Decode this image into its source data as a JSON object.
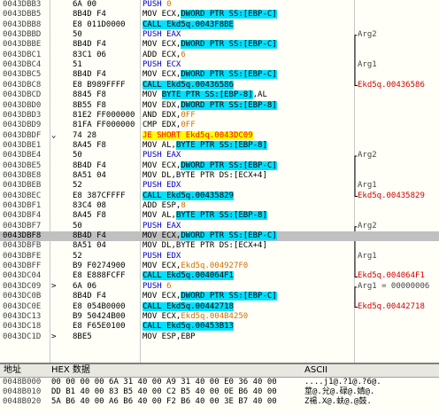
{
  "disasm": [
    {
      "addr": "0043DBB3",
      "hex": "6A 00",
      "parts": [
        [
          "PUSH ",
          "blue"
        ],
        [
          "0",
          "orange"
        ]
      ],
      "comment": ""
    },
    {
      "addr": "0043DBB5",
      "hex": "8B4D F4",
      "parts": [
        [
          "MOV ECX,",
          ""
        ],
        [
          "DWORD PTR SS:[EBP-C]",
          "hl"
        ]
      ],
      "comment": ""
    },
    {
      "addr": "0043DBB8",
      "hex": "E8 011D0000",
      "parts": [
        [
          "CALL Ekd5q.0043F8BE",
          "hl-call"
        ]
      ],
      "comment": ""
    },
    {
      "addr": "0043DBBD",
      "hex": "50",
      "parts": [
        [
          "PUSH EAX",
          "blue"
        ]
      ],
      "comment": "Arg2"
    },
    {
      "addr": "0043DBBE",
      "hex": "8B4D F4",
      "parts": [
        [
          "MOV ECX,",
          ""
        ],
        [
          "DWORD PTR SS:[EBP-C]",
          "hl"
        ]
      ],
      "comment": ""
    },
    {
      "addr": "0043DBC1",
      "hex": "83C1 06",
      "parts": [
        [
          "ADD ECX,",
          ""
        ],
        [
          "6",
          "orange"
        ]
      ],
      "comment": ""
    },
    {
      "addr": "0043DBC4",
      "hex": "51",
      "parts": [
        [
          "PUSH ECX",
          "blue"
        ]
      ],
      "comment": "Arg1"
    },
    {
      "addr": "0043DBC5",
      "hex": "8B4D F4",
      "parts": [
        [
          "MOV ECX,",
          ""
        ],
        [
          "DWORD PTR SS:[EBP-C]",
          "hl"
        ]
      ],
      "comment": ""
    },
    {
      "addr": "0043DBC8",
      "hex": "E8 B989FFFF",
      "parts": [
        [
          "CALL Ekd5q.00436586",
          "hl-call"
        ]
      ],
      "comment": "Ekd5q.00436586",
      "commentRed": true
    },
    {
      "addr": "0043DBCD",
      "hex": "8845 F8",
      "parts": [
        [
          "MOV ",
          ""
        ],
        [
          "BYTE PTR SS:[EBP-8]",
          "hl"
        ],
        [
          ",AL",
          ""
        ]
      ],
      "comment": ""
    },
    {
      "addr": "0043DBD0",
      "hex": "8B55 F8",
      "parts": [
        [
          "MOV EDX,",
          ""
        ],
        [
          "DWORD PTR SS:[EBP-8]",
          "hl"
        ]
      ],
      "comment": ""
    },
    {
      "addr": "0043DBD3",
      "hex": "81E2 FF000000",
      "parts": [
        [
          "AND EDX,",
          ""
        ],
        [
          "0FF",
          "orange"
        ]
      ],
      "comment": ""
    },
    {
      "addr": "0043DBD9",
      "hex": "81FA FF000000",
      "parts": [
        [
          "CMP EDX,",
          ""
        ],
        [
          "0FF",
          "orange"
        ]
      ],
      "comment": ""
    },
    {
      "addr": "0043DBDF",
      "hex": "74 28",
      "jmark": "⌄",
      "parts": [
        [
          "JE SHORT Ekd5q.0043DC09",
          "hl-jmp"
        ]
      ],
      "comment": ""
    },
    {
      "addr": "0043DBE1",
      "hex": "8A45 F8",
      "parts": [
        [
          "MOV AL,",
          ""
        ],
        [
          "BYTE PTR SS:[EBP-8]",
          "hl"
        ]
      ],
      "comment": ""
    },
    {
      "addr": "0043DBE4",
      "hex": "50",
      "parts": [
        [
          "PUSH EAX",
          "blue"
        ]
      ],
      "comment": "Arg2"
    },
    {
      "addr": "0043DBE5",
      "hex": "8B4D F4",
      "parts": [
        [
          "MOV ECX,",
          ""
        ],
        [
          "DWORD PTR SS:[EBP-C]",
          "hl"
        ]
      ],
      "comment": ""
    },
    {
      "addr": "0043DBE8",
      "hex": "8A51 04",
      "parts": [
        [
          "MOV DL,BYTE PTR DS:[ECX+4]",
          ""
        ]
      ],
      "comment": ""
    },
    {
      "addr": "0043DBEB",
      "hex": "52",
      "parts": [
        [
          "PUSH EDX",
          "blue"
        ]
      ],
      "comment": "Arg1"
    },
    {
      "addr": "0043DBEC",
      "hex": "E8 387CFFFF",
      "parts": [
        [
          "CALL Ekd5q.00435829",
          "hl-call"
        ]
      ],
      "comment": "Ekd5q.00435829",
      "commentRed": true
    },
    {
      "addr": "0043DBF1",
      "hex": "83C4 08",
      "parts": [
        [
          "ADD ESP,",
          ""
        ],
        [
          "8",
          "orange"
        ]
      ],
      "comment": ""
    },
    {
      "addr": "0043DBF4",
      "hex": "8A45 F8",
      "parts": [
        [
          "MOV AL,",
          ""
        ],
        [
          "BYTE PTR SS:[EBP-8]",
          "hl"
        ]
      ],
      "comment": ""
    },
    {
      "addr": "0043DBF7",
      "hex": "50",
      "parts": [
        [
          "PUSH EAX",
          "blue"
        ]
      ],
      "comment": "Arg2"
    },
    {
      "addr": "0043DBF8",
      "hex": "8B4D F4",
      "selected": true,
      "parts": [
        [
          "MOV ECX,",
          ""
        ],
        [
          "DWORD PTR SS:[EBP-C]",
          "hl"
        ]
      ],
      "comment": ""
    },
    {
      "addr": "0043DBFB",
      "hex": "8A51 04",
      "parts": [
        [
          "MOV DL,BYTE PTR DS:[ECX+4]",
          ""
        ]
      ],
      "comment": ""
    },
    {
      "addr": "0043DBFE",
      "hex": "52",
      "parts": [
        [
          "PUSH EDX",
          "blue"
        ]
      ],
      "comment": "Arg1"
    },
    {
      "addr": "0043DBFF",
      "hex": "B9 F0274900",
      "parts": [
        [
          "MOV ECX,",
          ""
        ],
        [
          "Ekd5q.004927F0",
          "orange"
        ]
      ],
      "comment": ""
    },
    {
      "addr": "0043DC04",
      "hex": "E8 E888FCFF",
      "parts": [
        [
          "CALL Ekd5q.004064F1",
          "hl-call"
        ]
      ],
      "comment": "Ekd5q.004064F1",
      "commentRed": true
    },
    {
      "addr": "0043DC09",
      "hex": "6A 06",
      "jmark": ">",
      "parts": [
        [
          "PUSH ",
          "blue"
        ],
        [
          "6",
          "orange"
        ]
      ],
      "comment": "Arg1 = 00000006"
    },
    {
      "addr": "0043DC0B",
      "hex": "8B4D F4",
      "parts": [
        [
          "MOV ECX,",
          ""
        ],
        [
          "DWORD PTR SS:[EBP-C]",
          "hl"
        ]
      ],
      "comment": ""
    },
    {
      "addr": "0043DC0E",
      "hex": "E8 054B0000",
      "parts": [
        [
          "CALL Ekd5q.00442718",
          "hl-call"
        ]
      ],
      "comment": "Ekd5q.00442718",
      "commentRed": true
    },
    {
      "addr": "0043DC13",
      "hex": "B9 50424B00",
      "parts": [
        [
          "MOV ECX,",
          ""
        ],
        [
          "Ekd5q.004B4250",
          "orange"
        ]
      ],
      "comment": ""
    },
    {
      "addr": "0043DC18",
      "hex": "E8 F65E0100",
      "parts": [
        [
          "CALL Ekd5q.00453B13",
          "hl-call"
        ]
      ],
      "comment": ""
    },
    {
      "addr": "0043DC1D",
      "hex": "8BE5",
      "jmark": ">",
      "parts": [
        [
          "MOV ESP,EBP",
          ""
        ]
      ],
      "comment": ""
    }
  ],
  "hexpane": {
    "header": {
      "addr": "地址",
      "hex": "HEX 数据",
      "ascii": "ASCII"
    },
    "rows": [
      {
        "addr": "0048B000",
        "bytes": "00 00 00 00 6A 31 40 00 A9 31 40 00 E0 36 40 00",
        "ascii": "....j1@.?1@.?6@."
      },
      {
        "addr": "0048B010",
        "bytes": "DD B1 40 00 83 B5 40 00 C2 B5 40 00 0E B6 40 00",
        "ascii": "莖@.兊@.碌@.婧@."
      },
      {
        "addr": "0048B020",
        "bytes": "5A B6 40 00 A6 B6 40 00 F2 B6 40 00 3E B7 40 00",
        "ascii": "Z禓.X@.蚨@.@鼓."
      }
    ]
  }
}
